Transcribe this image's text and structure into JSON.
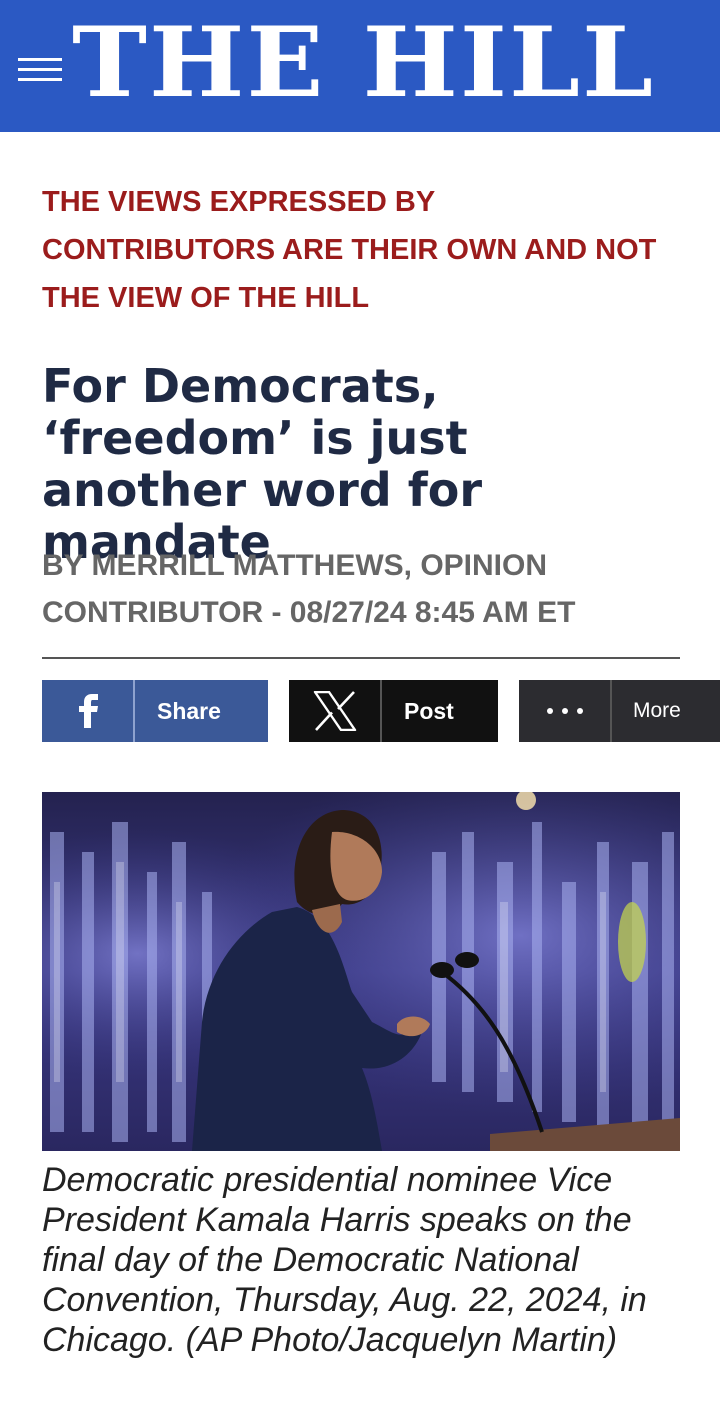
{
  "header": {
    "logo_text": "THE HILL",
    "brand_color": "#2b59c3",
    "menu_icon": "hamburger-menu-icon"
  },
  "article": {
    "disclaimer": "THE VIEWS EXPRESSED BY CONTRIBUTORS ARE THEIR OWN AND NOT THE VIEW OF THE HILL",
    "headline": "For Democrats, ‘freedom’ is just another word for mandate",
    "byline": "BY MERRILL MATTHEWS, OPINION CONTRIBUTOR - 08/27/24 8:45 AM ET",
    "image_caption": "Democratic presidential nominee Vice President Kamala Harris speaks on the final day of the Democratic National Convention, Thursday, Aug. 22, 2024, in Chicago. (AP Photo/Jacquelyn Martin)"
  },
  "share_bar": {
    "facebook": {
      "icon": "facebook-icon",
      "label": "Share",
      "color": "#3b5998"
    },
    "x": {
      "icon": "x-logo-icon",
      "label": "Post",
      "color": "#111111"
    },
    "more": {
      "icon": "more-dots-icon",
      "label": "More",
      "color": "#2c2c30"
    }
  },
  "colors": {
    "disclaimer": "#9b1c1c",
    "headline": "#1f2a44",
    "byline": "#666666"
  }
}
